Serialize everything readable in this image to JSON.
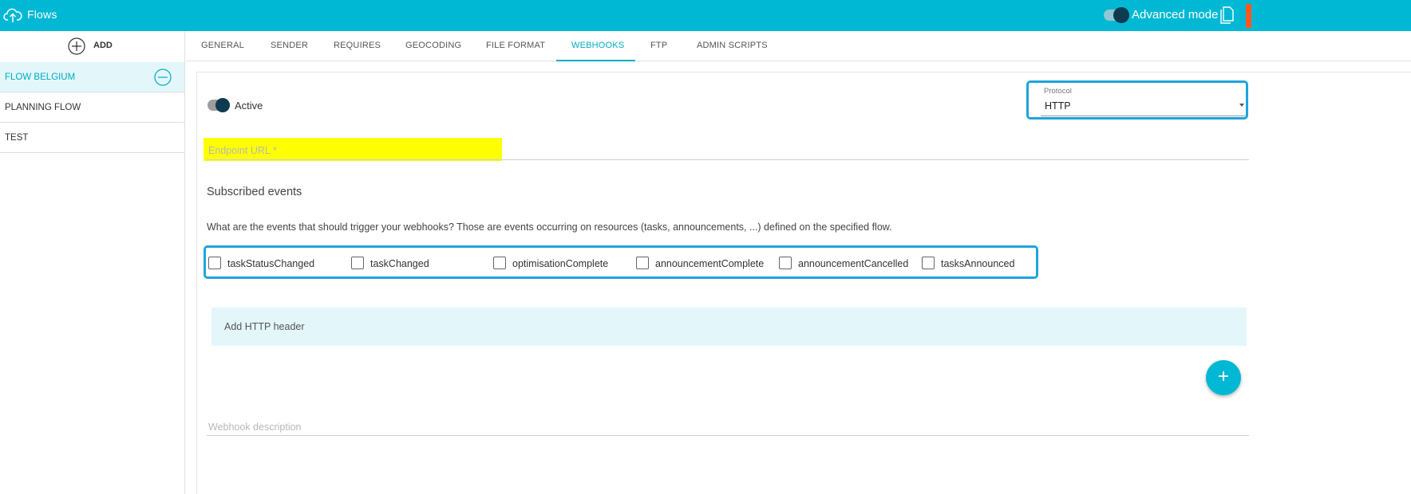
{
  "topbar": {
    "title": "Flows",
    "advanced_mode_label": "Advanced mode",
    "accent_color": "#00b8d4"
  },
  "sidebar": {
    "add_label": "ADD",
    "items": [
      {
        "label": "FLOW BELGIUM",
        "active": true
      },
      {
        "label": "PLANNING FLOW",
        "active": false
      },
      {
        "label": "TEST",
        "active": false
      }
    ]
  },
  "tabs": [
    {
      "label": "GENERAL"
    },
    {
      "label": "SENDER"
    },
    {
      "label": "REQUIRES"
    },
    {
      "label": "GEOCODING"
    },
    {
      "label": "FILE FORMAT"
    },
    {
      "label": "WEBHOOKS",
      "active": true
    },
    {
      "label": "FTP"
    },
    {
      "label": "ADMIN SCRIPTS"
    }
  ],
  "webhook": {
    "active_label": "Active",
    "protocol_caption": "Protocol",
    "protocol_value": "HTTP",
    "endpoint_label": "Endpoint URL *",
    "subscribed_title": "Subscribed events",
    "events_description": "What are the events that should trigger your webhooks? Those are events occurring on resources (tasks, announcements, ...) defined on the specified flow.",
    "events": [
      {
        "label": "taskStatusChanged"
      },
      {
        "label": "taskChanged"
      },
      {
        "label": "optimisationComplete"
      },
      {
        "label": "announcementComplete"
      },
      {
        "label": "announcementCancelled"
      },
      {
        "label": "tasksAnnounced"
      }
    ],
    "add_header_label": "Add HTTP header",
    "fab_symbol": "+",
    "description_label": "Webhook description"
  }
}
